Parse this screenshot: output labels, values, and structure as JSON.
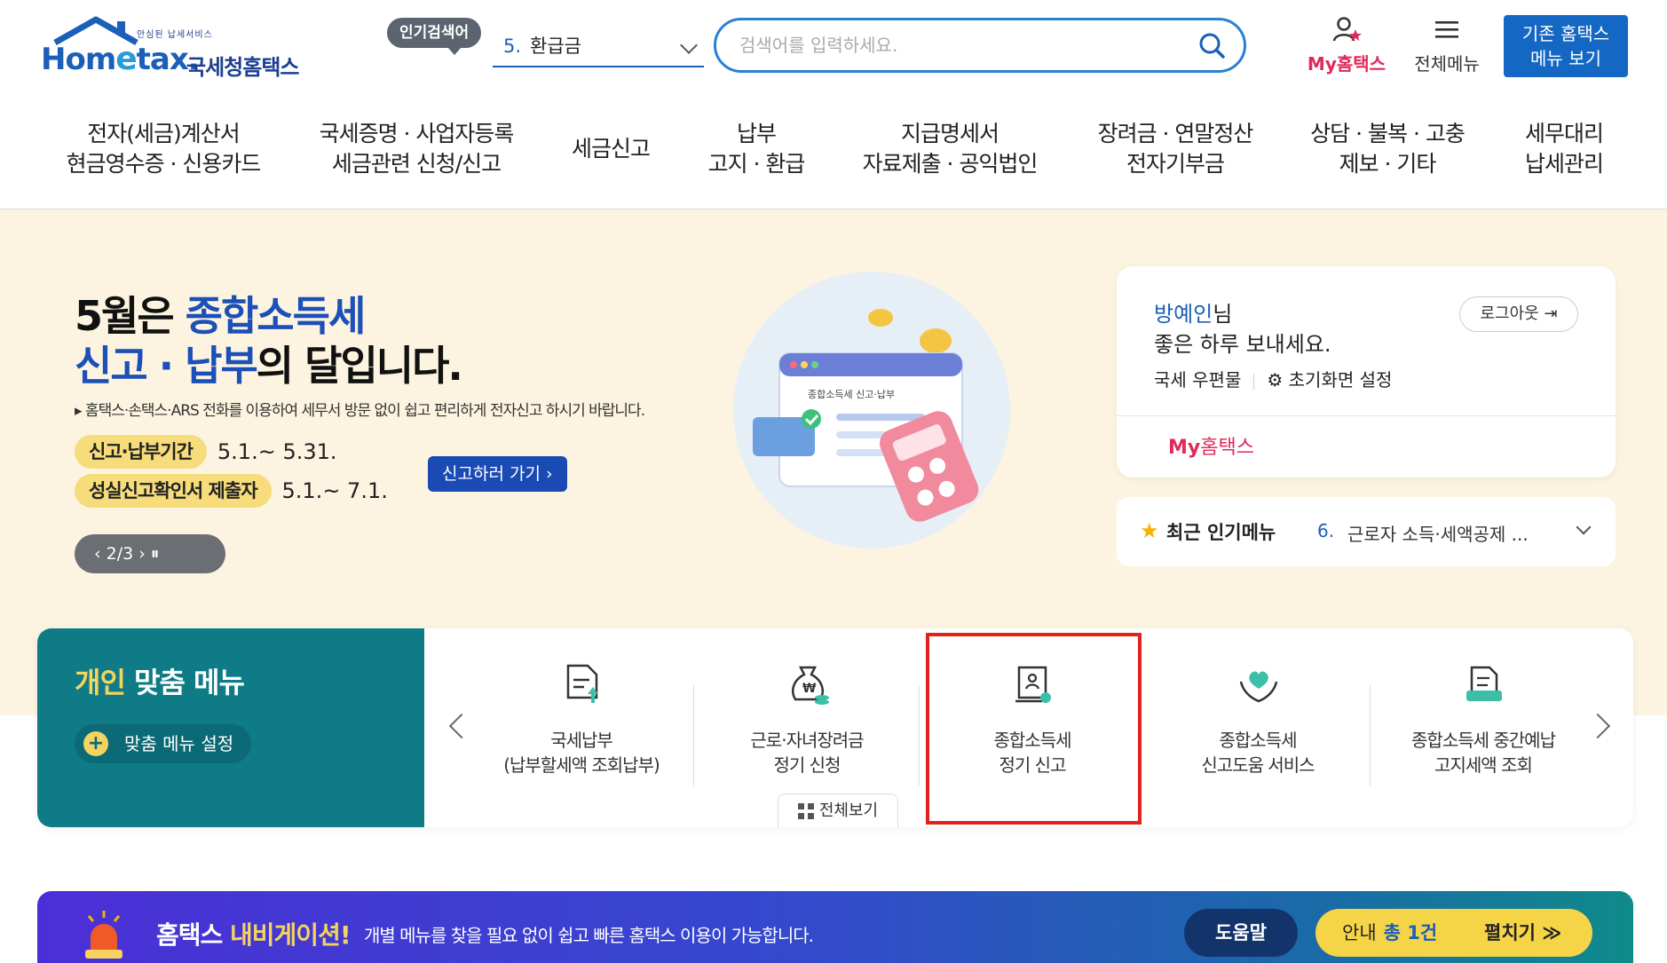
{
  "header": {
    "logo": {
      "tagline": "안심된 납세서비스",
      "brand_prefix": "Hom",
      "brand_e": "e",
      "brand_suffix": "tax.",
      "sub": "국세청홈택스"
    },
    "popular_badge": "인기검색어",
    "popular_select": {
      "num": "5.",
      "value": "환급금"
    },
    "search": {
      "placeholder": "검색어를 입력하세요."
    },
    "my_hometax": "My홈택스",
    "all_menu": "전체메뉴",
    "old_menu_line1": "기존 홈택스",
    "old_menu_line2": "메뉴 보기"
  },
  "nav": [
    {
      "line1": "전자(세금)계산서",
      "line2": "현금영수증 · 신용카드"
    },
    {
      "line1": "국세증명 · 사업자등록",
      "line2": "세금관련 신청/신고"
    },
    {
      "line1": "세금신고",
      "line2": ""
    },
    {
      "line1": "납부",
      "line2": "고지 · 환급"
    },
    {
      "line1": "지급명세서",
      "line2": "자료제출 · 공익법인"
    },
    {
      "line1": "장려금 · 연말정산",
      "line2": "전자기부금"
    },
    {
      "line1": "상담 · 불복 · 고충",
      "line2": "제보 · 기타"
    },
    {
      "line1": "세무대리",
      "line2": "납세관리"
    }
  ],
  "hero": {
    "title_a": "5월은 ",
    "title_b": "종합소득세",
    "title_c": "신고 · 납부",
    "title_d": "의 달입니다.",
    "desc": "▸ 홈택스·손택스·ARS 전화를 이용하여 세무서 방문 없이 쉽고 편리하게 전자신고 하시기 바랍니다.",
    "period1_label": "신고·납부기간",
    "period1_value": "5.1.~ 5.31.",
    "period2_label": "성실신고확인서 제출자",
    "period2_value": "5.1.~ 7.1.",
    "go_button": "신고하러 가기 ›",
    "slider": "‹  2/3  ›    ⏸",
    "art_label": "종합소득세 신고·납부"
  },
  "user_card": {
    "user": "방예인",
    "suffix": "님",
    "greeting": "좋은 하루 보내세요.",
    "logout": "로그아웃",
    "mail": "국세 우편물",
    "settings": "초기화면 설정",
    "my_prefix": "My",
    "my_suffix": "홈택스"
  },
  "recent": {
    "label": "최근 인기메뉴",
    "num": "6.",
    "value": "근로자 소득·세액공제 ..."
  },
  "personal_menu": {
    "title_a": "개인",
    "title_b": " 맞춤 메뉴",
    "settings": "맞춤 메뉴 설정",
    "view_all": "전체보기",
    "items": [
      {
        "line1": "국세납부",
        "line2": "(납부할세액 조회납부)",
        "icon": "tax-payment-icon"
      },
      {
        "line1": "근로·자녀장려금",
        "line2": "정기 신청",
        "icon": "money-bag-icon"
      },
      {
        "line1": "종합소득세",
        "line2": "정기 신고",
        "icon": "income-tax-report-icon"
      },
      {
        "line1": "종합소득세",
        "line2": "신고도움 서비스",
        "icon": "heart-hands-icon"
      },
      {
        "line1": "종합소득세 중간예납",
        "line2": "고지세액 조회",
        "icon": "document-inquiry-icon"
      }
    ]
  },
  "navi_banner": {
    "title_a": "홈택스 ",
    "title_b": "내비게이션!",
    "desc": "개별 메뉴를 찾을 필요 없이 쉽고 빠른 홈택스 이용이 가능합니다.",
    "help": "도움말",
    "info_label": "안내",
    "info_count": "총 1건",
    "expand": "펼치기 ≫"
  },
  "colors": {
    "brand": "#1c5fb8",
    "accent_pink": "#e0295c",
    "teal": "#0e7b87",
    "highlight": "#e2231a",
    "hero_bg": "#fcf4e0"
  }
}
